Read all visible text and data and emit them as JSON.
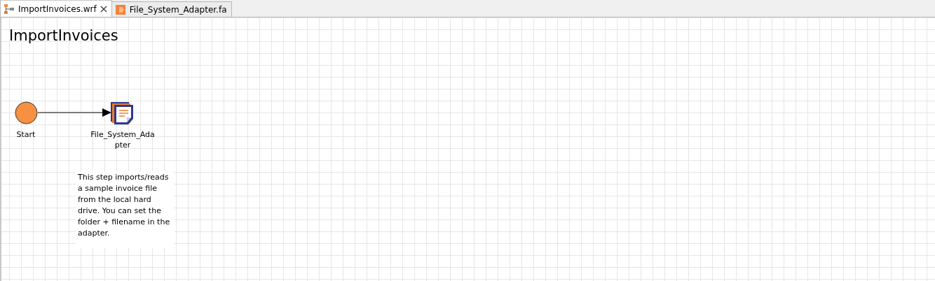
{
  "tabs": [
    {
      "label": "ImportInvoices.wrf",
      "selected": true,
      "kind": "workflow",
      "closable": true
    },
    {
      "label": "File_System_Adapter.fa",
      "selected": false,
      "kind": "adapter",
      "closable": false
    }
  ],
  "canvas": {
    "title": "ImportInvoices",
    "nodes": [
      {
        "kind": "start",
        "label": "Start"
      },
      {
        "kind": "adapter",
        "label": "File_System_Adapter"
      }
    ],
    "note": "This step imports/reads a sample invoice file from the local hard drive. You can set the folder + filename in the adapter."
  }
}
